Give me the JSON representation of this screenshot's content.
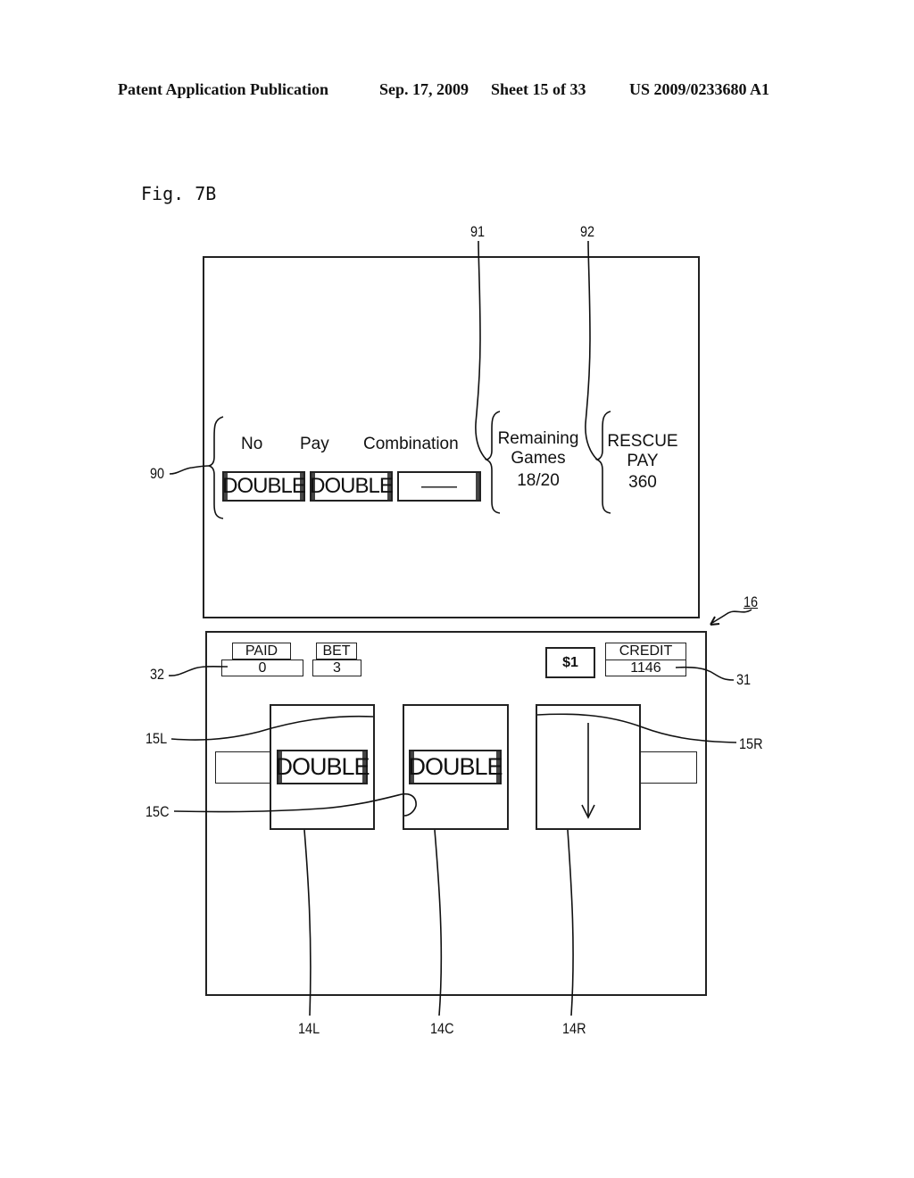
{
  "header": {
    "publication": "Patent Application Publication",
    "date": "Sep. 17, 2009",
    "sheet": "Sheet 15 of 33",
    "number": "US 2009/0233680 A1"
  },
  "figure_label": "Fig. 7B",
  "upper_display": {
    "ref_info_area": "90",
    "ref_remaining": "91",
    "ref_rescue": "92",
    "columns": [
      "No",
      "Pay",
      "Combination"
    ],
    "cells": [
      "DOUBLE",
      "DOUBLE",
      "——"
    ],
    "remaining_label_1": "Remaining",
    "remaining_label_2": "Games",
    "remaining_value": "18/20",
    "rescue_label_1": "RESCUE",
    "rescue_label_2": "PAY",
    "rescue_value": "360"
  },
  "lower_display": {
    "ref_display": "16",
    "ref_credit": "31",
    "ref_paid": "32",
    "paid_label": "PAID",
    "paid_value": "0",
    "bet_label": "BET",
    "bet_value": "3",
    "denomination": "$1",
    "credit_label": "CREDIT",
    "credit_value": "1146",
    "reels": {
      "left_symbol": "DOUBLE",
      "center_symbol": "DOUBLE",
      "right_state": "spinning"
    },
    "ref_15L": "15L",
    "ref_15C": "15C",
    "ref_15R": "15R",
    "ref_14L": "14L",
    "ref_14C": "14C",
    "ref_14R": "14R"
  }
}
